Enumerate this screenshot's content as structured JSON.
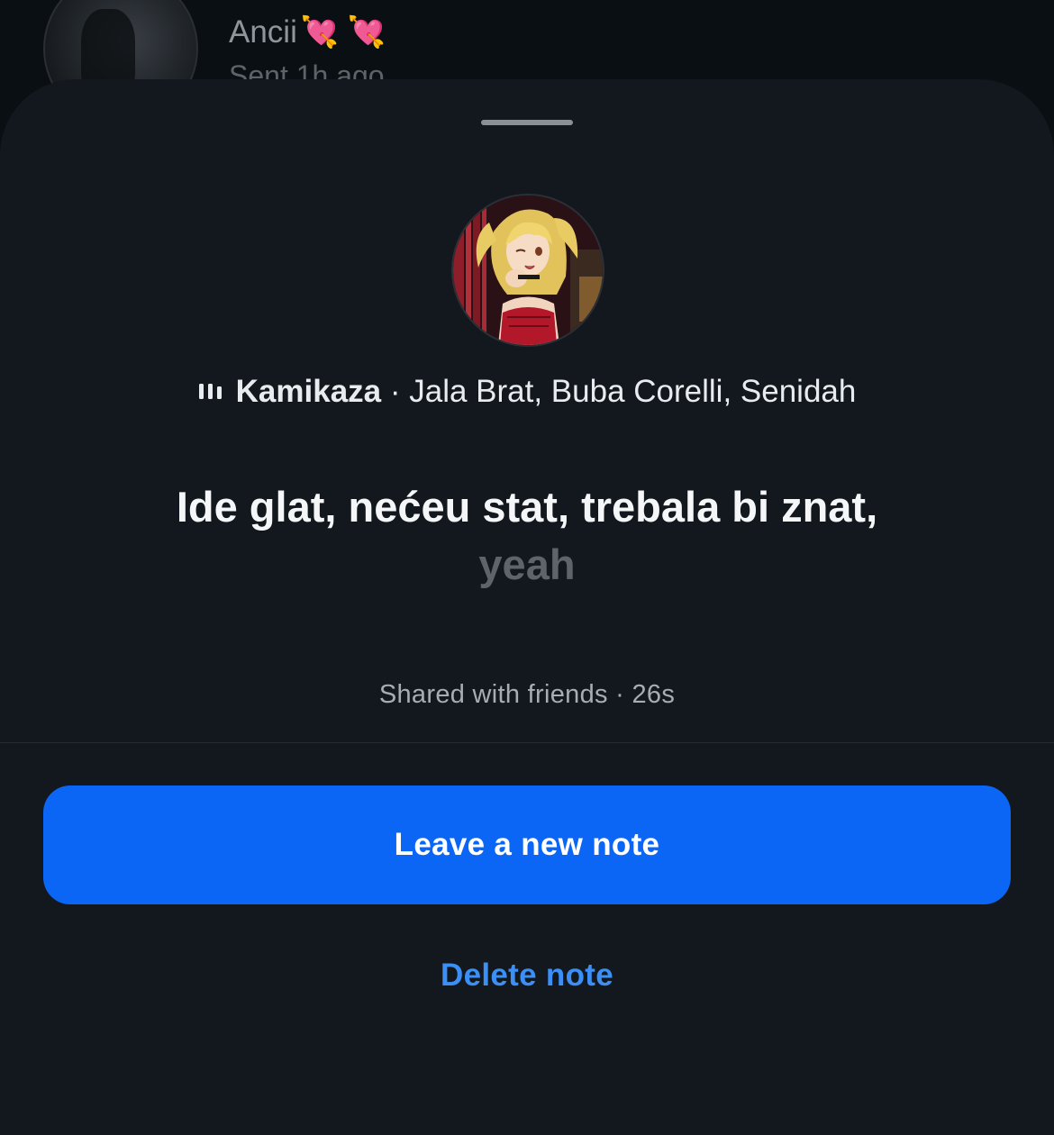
{
  "background_thread": {
    "name": "Ancii",
    "name_emoji": "💘 💘",
    "subtitle": "Sent 1h ago"
  },
  "note": {
    "song_title": "Kamikaza",
    "separator": " · ",
    "song_artists": "Jala Brat, Buba Corelli, Senidah",
    "lyric_main": "Ide glat, nećeu stat, trebala bi znat,",
    "lyric_dim": "yeah",
    "shared_text": "Shared with friends · 26s"
  },
  "actions": {
    "primary_label": "Leave a new note",
    "secondary_label": "Delete note"
  },
  "colors": {
    "primary_button": "#0c66f5",
    "link": "#3b8ff5",
    "sheet_bg": "#12181e"
  }
}
